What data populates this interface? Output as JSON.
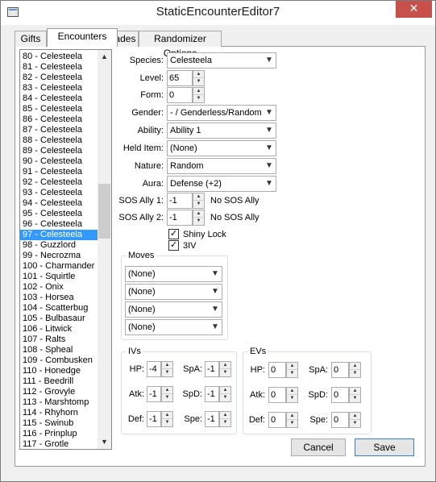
{
  "window": {
    "title": "StaticEncounterEditor7",
    "close_glyph": "✕"
  },
  "tabs": [
    {
      "label": "Gifts"
    },
    {
      "label": "Encounters"
    },
    {
      "label": "Trades"
    },
    {
      "label": "Randomizer Options"
    }
  ],
  "list": {
    "items": [
      "80 - Celesteela",
      "81 - Celesteela",
      "82 - Celesteela",
      "83 - Celesteela",
      "84 - Celesteela",
      "85 - Celesteela",
      "86 - Celesteela",
      "87 - Celesteela",
      "88 - Celesteela",
      "89 - Celesteela",
      "90 - Celesteela",
      "91 - Celesteela",
      "92 - Celesteela",
      "93 - Celesteela",
      "94 - Celesteela",
      "95 - Celesteela",
      "96 - Celesteela",
      "97 - Celesteela",
      "98 - Guzzlord",
      "99 - Necrozma",
      "100 - Charmander",
      "101 - Squirtle",
      "102 - Onix",
      "103 - Horsea",
      "104 - Scatterbug",
      "105 - Bulbasaur",
      "106 - Litwick",
      "107 - Ralts",
      "108 - Spheal",
      "109 - Combusken",
      "110 - Honedge",
      "111 - Beedrill",
      "112 - Grovyle",
      "113 - Marshtomp",
      "114 - Rhyhorn",
      "115 - Swinub",
      "116 - Prinplup",
      "117 - Grotle"
    ],
    "selected_index": 17
  },
  "form": {
    "species_label": "Species:",
    "species_value": "Celesteela",
    "level_label": "Level:",
    "level_value": "65",
    "form_label": "Form:",
    "form_value": "0",
    "gender_label": "Gender:",
    "gender_value": "- / Genderless/Random",
    "ability_label": "Ability:",
    "ability_value": "Ability 1",
    "helditem_label": "Held Item:",
    "helditem_value": "(None)",
    "nature_label": "Nature:",
    "nature_value": "Random",
    "aura_label": "Aura:",
    "aura_value": "Defense (+2)",
    "sos1_label": "SOS Ally 1:",
    "sos1_value": "-1",
    "sos1_text": "No SOS Ally",
    "sos2_label": "SOS Ally 2:",
    "sos2_value": "-1",
    "sos2_text": "No SOS Ally",
    "shiny_label": "Shiny Lock",
    "shiny_checked": true,
    "iv3_label": "3IV",
    "iv3_checked": true,
    "check_glyph": "✓"
  },
  "moves": {
    "title": "Moves",
    "values": [
      "(None)",
      "(None)",
      "(None)",
      "(None)"
    ]
  },
  "ivs": {
    "title": "IVs",
    "hp_label": "HP:",
    "hp": "-4",
    "atk_label": "Atk:",
    "atk": "-1",
    "def_label": "Def:",
    "def": "-1",
    "spa_label": "SpA:",
    "spa": "-1",
    "spd_label": "SpD:",
    "spd": "-1",
    "spe_label": "Spe:",
    "spe": "-1"
  },
  "evs": {
    "title": "EVs",
    "hp_label": "HP:",
    "hp": "0",
    "atk_label": "Atk:",
    "atk": "0",
    "def_label": "Def:",
    "def": "0",
    "spa_label": "SpA:",
    "spa": "0",
    "spd_label": "SpD:",
    "spd": "0",
    "spe_label": "Spe:",
    "spe": "0"
  },
  "buttons": {
    "cancel": "Cancel",
    "save": "Save"
  },
  "icons": {
    "combo_arrow": "▼",
    "spin_up": "▲",
    "spin_down": "▼",
    "scroll_up": "▲",
    "scroll_down": "▼"
  },
  "colors": {
    "selection": "#3399ff",
    "close_button": "#c7504a"
  }
}
